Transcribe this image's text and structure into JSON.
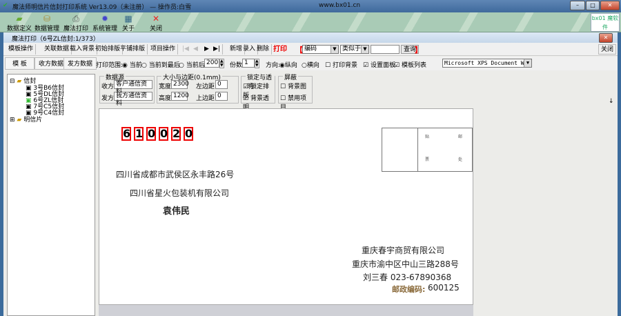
{
  "window": {
    "title": "魔法师明信片信封打印系统 Ver13.09（未注册） — 操作员:白雪",
    "url": "www.bx01.cn",
    "min": "–",
    "max": "□",
    "close": "✕"
  },
  "toolbar": [
    {
      "label": "数据定义",
      "icon": "data-define-icon"
    },
    {
      "label": "数据管理",
      "icon": "data-manage-icon"
    },
    {
      "label": "魔法打印",
      "icon": "printer-icon"
    },
    {
      "label": "系统管理",
      "icon": "gear-icon"
    },
    {
      "label": "关于",
      "icon": "about-icon"
    },
    {
      "label": "关闭",
      "icon": "close-icon"
    }
  ],
  "logo": {
    "text": "bx01 魔软件"
  },
  "inner": {
    "title": "魔法打印（6号ZL信封:1/373）",
    "close": "✕"
  },
  "row1": {
    "template_ops": "模板操作",
    "link_data": "关联数据",
    "load_bg": "载入背景",
    "init_layout": "初始排版",
    "tile_layout": "平铺排版",
    "item_ops": "项目操作",
    "nav": [
      "|◀",
      "◀",
      "▶",
      "▶|"
    ],
    "add": "新增",
    "entry": "录入",
    "delete": "删除",
    "print": "打印",
    "field": "编码",
    "match": "类似于",
    "search_value": "",
    "search": "查询",
    "close": "关闭"
  },
  "row2": {
    "tabs": [
      "模 板",
      "收方数据",
      "发方数据"
    ],
    "range_label": "打印范围:",
    "range_opts": [
      "当前",
      "当前到最后",
      "当前后"
    ],
    "range_count": "200",
    "copies_label": "份数",
    "copies": "1",
    "dir_label": "方向:",
    "dir_opts": [
      "纵向",
      "横向"
    ],
    "print_bg": "打印背景",
    "set_panel": "设置面板",
    "template_list": "模板列表",
    "printer": "Microsoft XPS Document Wri"
  },
  "tree": {
    "root": "信封",
    "items": [
      "3号B6信封",
      "5号DL信封",
      "6号ZL信封",
      "7号C5信封",
      "9号C4信封"
    ],
    "root2": "明信片"
  },
  "panel": {
    "datasource": "数据源",
    "recv_label": "收方",
    "recv": "客户通信资料",
    "send_label": "发方",
    "send": "我方通信资料",
    "size": "大小与边距(0.1mm)",
    "width_label": "宽度",
    "width": "2300",
    "height_label": "高度",
    "height": "1200",
    "left_label": "左边距",
    "left": "0",
    "top_label": "上边距",
    "top": "0",
    "lock": "锁定与透明",
    "lock_layout": "锁定排版",
    "bg_transparent": "背景透明",
    "mask": "屏蔽",
    "bg_image": "背景图",
    "disable_items": "禁用项目"
  },
  "envelope": {
    "zip": [
      "6",
      "1",
      "0",
      "0",
      "2",
      "0"
    ],
    "stamp": [
      "贴",
      "邮",
      "票",
      "处"
    ],
    "recv_addr": "四川省成都市武侯区永丰路26号",
    "recv_company": "四川省星火包装机有限公司",
    "recv_name": "袁伟民",
    "send_company": "重庆春宇商贸有限公司",
    "send_addr": "重庆市渝中区中山三路288号",
    "send_contact": "刘三春   023-67890368",
    "send_zip_label": "邮政编码:",
    "send_zip": "600125"
  }
}
